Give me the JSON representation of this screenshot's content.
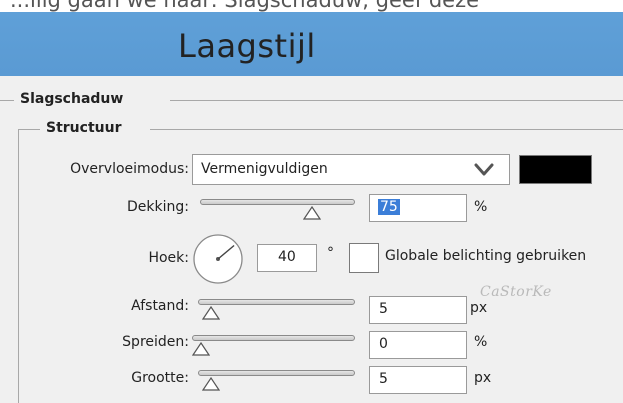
{
  "header": {
    "cropped_text": "...ilig gaan we naar: Slagschaduw, geef deze",
    "title": "Laagstijl"
  },
  "groups": {
    "outer_label": "Slagschaduw",
    "inner_label": "Structuur"
  },
  "blend_mode": {
    "label": "Overvloeimodus:",
    "value": "Vermenigvuldigen",
    "color": "#000000"
  },
  "opacity": {
    "label": "Dekking:",
    "value": "75",
    "unit": "%",
    "slider_fraction": 0.75
  },
  "angle": {
    "label": "Hoek:",
    "value": "40",
    "unit": "°",
    "global_light_label": "Globale belichting gebruiken",
    "global_light_checked": false
  },
  "distance": {
    "label": "Afstand:",
    "value": "5",
    "unit": "px",
    "slider_fraction": 0.03
  },
  "spread": {
    "label": "Spreiden:",
    "value": "0",
    "unit": "%",
    "slider_fraction": 0.0
  },
  "size": {
    "label": "Grootte:",
    "value": "5",
    "unit": "px",
    "slider_fraction": 0.03
  },
  "watermark": "CaStorKe",
  "colors": {
    "title_bar": "#5b9bd5",
    "panel_bg": "#f0f0f0",
    "selection": "#3b7ed8"
  }
}
